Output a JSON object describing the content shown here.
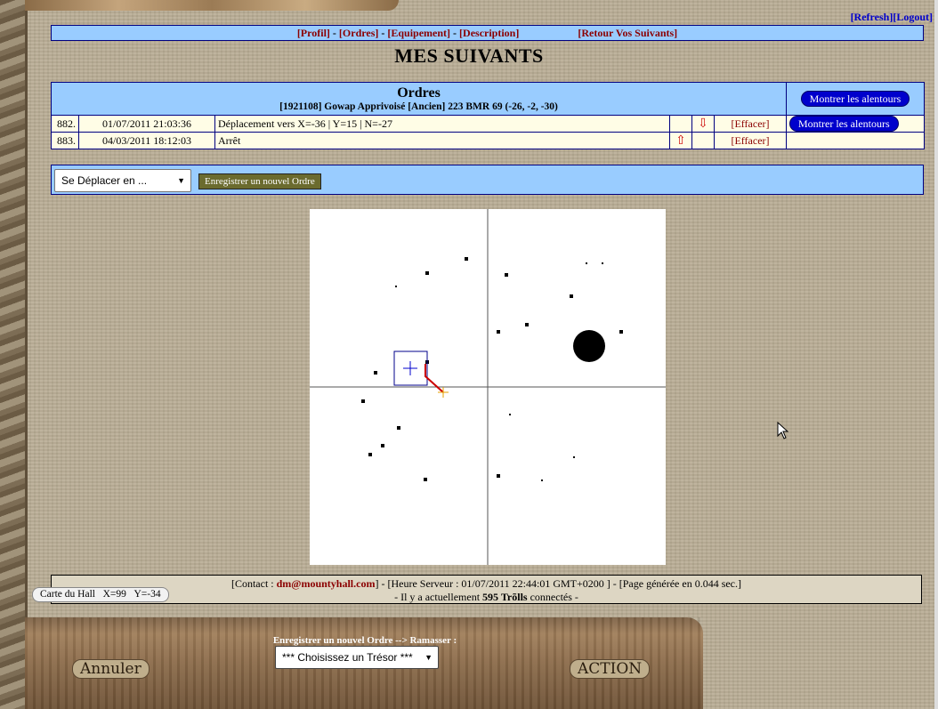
{
  "top_links": {
    "refresh": "[Refresh]",
    "logout": "[Logout]"
  },
  "nav": {
    "profil": "[Profil]",
    "ordres": "[Ordres]",
    "equipement": "[Equipement]",
    "description": "[Description]",
    "retour": "[Retour Vos Suivants]",
    "sep": " - "
  },
  "page_title": "MES SUIVANTS",
  "orders": {
    "title": "Ordres",
    "subtitle": "[1921108] Gowap Apprivoisé [Ancien] 223 BMR 69 (-26, -2, -30)",
    "header_button": "Montrer les alentours",
    "rows": [
      {
        "num": "882.",
        "date": "01/07/2011 21:03:36",
        "text": "Déplacement vers X=-36 | Y=15 | N=-27",
        "delete": "[Effacer]",
        "button": "Montrer les alentours"
      },
      {
        "num": "883.",
        "date": "04/03/2011 18:12:03",
        "text": "Arrêt",
        "delete": "[Effacer]",
        "button": ""
      }
    ]
  },
  "new_order": {
    "select_value": "Se Déplacer en ...",
    "save_button": "Enregistrer un nouvel Ordre"
  },
  "footer": {
    "contact_label": "[Contact : ",
    "contact_email": "dm@mountyhall.com",
    "server_info": "] - [Heure Serveur : 01/07/2011 22:44:01 GMT+0200 ] - [Page générée en 0.044 sec.]",
    "line2_pre": "- Il y a actuellement ",
    "count": "595 Trõlls",
    "line2_post": " connectés -"
  },
  "carte": {
    "label": "Carte du Hall",
    "x": "X=99",
    "y": "Y=-34"
  },
  "bottom_bar": {
    "label": "Enregistrer un nouvel Ordre --> Ramasser :",
    "select_value": "*** Choisissez un Trésor ***",
    "cancel": "Annuler",
    "action": "ACTION"
  },
  "colors": {
    "panel_blue": "#99ccff",
    "row_cream": "#fffde6",
    "link_red": "#8b0000",
    "button_blue": "#0000cc"
  }
}
